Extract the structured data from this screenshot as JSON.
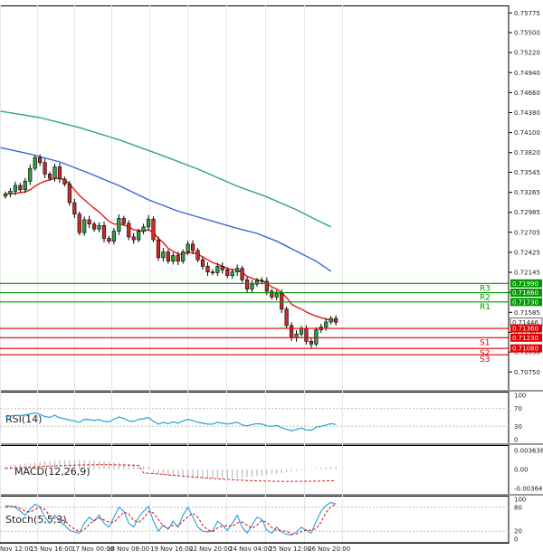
{
  "chart_data": {
    "type": "candlestick",
    "price_axis": {
      "range": [
        0.705,
        0.7588
      ],
      "ticks": [
        "0.75775",
        "0.75500",
        "0.75220",
        "0.74940",
        "0.74660",
        "0.74380",
        "0.74100",
        "0.73820",
        "0.73545",
        "0.73265",
        "0.72985",
        "0.72705",
        "0.72425",
        "0.72145",
        "0.71865",
        "0.71585",
        "0.71305",
        "0.71030",
        "0.70750"
      ]
    },
    "x_ticks": [
      "Nov 12:00",
      "15 Nov 16:00",
      "17 Nov 00:00",
      "18 Nov 08:00",
      "19 Nov 16:00",
      "22 Nov 20:00",
      "24 Nov 04:00",
      "25 Nov 12:00",
      "26 Nov 20:00"
    ],
    "current_price": "0.71446",
    "levels": [
      {
        "name": "R3",
        "value": "0.71990",
        "price": 0.7199,
        "color": "#009900"
      },
      {
        "name": "R2",
        "value": "0.71860",
        "price": 0.7186,
        "color": "#009900"
      },
      {
        "name": "R1",
        "value": "0.71730",
        "price": 0.7173,
        "color": "#009900"
      },
      {
        "name": "",
        "value": "0.71360",
        "price": 0.7136,
        "color": "#e00000"
      },
      {
        "name": "S1",
        "value": "0.71230",
        "price": 0.7123,
        "color": "#e00000"
      },
      {
        "name": "S2",
        "value": "0.71080",
        "price": 0.7108,
        "color": "#e00000"
      },
      {
        "name": "S3",
        "value": "",
        "price": 0.7108,
        "color": "#e00000"
      }
    ],
    "close": [
      0.7324,
      0.7328,
      0.7336,
      0.733,
      0.7342,
      0.736,
      0.7375,
      0.7368,
      0.7352,
      0.7346,
      0.7362,
      0.7345,
      0.7338,
      0.7312,
      0.7296,
      0.727,
      0.7288,
      0.7282,
      0.7275,
      0.728,
      0.7262,
      0.7258,
      0.7272,
      0.729,
      0.7283,
      0.7264,
      0.726,
      0.7272,
      0.7278,
      0.7289,
      0.726,
      0.7235,
      0.7243,
      0.723,
      0.7238,
      0.723,
      0.7243,
      0.7254,
      0.7245,
      0.7232,
      0.7223,
      0.7215,
      0.7214,
      0.7223,
      0.7218,
      0.721,
      0.7215,
      0.722,
      0.7204,
      0.7191,
      0.7198,
      0.7203,
      0.7202,
      0.7188,
      0.718,
      0.7185,
      0.7163,
      0.714,
      0.7123,
      0.7128,
      0.7136,
      0.7118,
      0.7114,
      0.7134,
      0.7138,
      0.7145,
      0.715,
      0.71446
    ],
    "ma_fast": [
      0.7324,
      0.7325,
      0.7325,
      0.7326,
      0.7327,
      0.733,
      0.7335,
      0.7339,
      0.7342,
      0.7344,
      0.7346,
      0.7346,
      0.7344,
      0.7338,
      0.733,
      0.7322,
      0.7316,
      0.731,
      0.7304,
      0.7299,
      0.7292,
      0.7286,
      0.7282,
      0.7282,
      0.7281,
      0.7278,
      0.7274,
      0.7273,
      0.7272,
      0.7274,
      0.727,
      0.7262,
      0.7256,
      0.7248,
      0.7244,
      0.724,
      0.724,
      0.7242,
      0.7242,
      0.724,
      0.7236,
      0.7232,
      0.7228,
      0.7226,
      0.7223,
      0.722,
      0.7218,
      0.7218,
      0.7214,
      0.7209,
      0.7206,
      0.7204,
      0.7203,
      0.7199,
      0.7194,
      0.7191,
      0.7186,
      0.7179,
      0.717,
      0.7166,
      0.7163,
      0.7159,
      0.7156,
      0.7153,
      0.7151,
      0.7149,
      0.7148,
      0.7147
    ]
  },
  "ma_blue": [
    [
      0,
      0.7389
    ],
    [
      6,
      0.738
    ],
    [
      12,
      0.7369
    ],
    [
      18,
      0.7353
    ],
    [
      24,
      0.7336
    ],
    [
      30,
      0.7316
    ],
    [
      36,
      0.73
    ],
    [
      42,
      0.7288
    ],
    [
      48,
      0.7276
    ],
    [
      52,
      0.7269
    ],
    [
      56,
      0.7258
    ],
    [
      60,
      0.7244
    ],
    [
      64,
      0.723
    ],
    [
      67,
      0.7216
    ]
  ],
  "ma_green": [
    [
      0,
      0.744
    ],
    [
      8,
      0.7431
    ],
    [
      16,
      0.7417
    ],
    [
      24,
      0.74
    ],
    [
      32,
      0.738
    ],
    [
      40,
      0.7359
    ],
    [
      48,
      0.7335
    ],
    [
      54,
      0.732
    ],
    [
      60,
      0.7302
    ],
    [
      64,
      0.7288
    ],
    [
      67,
      0.7278
    ]
  ],
  "rsi": {
    "label": "RSI(14)",
    "ticks": [
      "100",
      "70",
      "30",
      "0"
    ],
    "values": [
      52,
      53,
      55,
      54,
      56,
      58,
      60,
      57,
      52,
      50,
      55,
      49,
      47,
      44,
      42,
      39,
      46,
      45,
      43,
      45,
      41,
      40,
      46,
      51,
      48,
      42,
      41,
      46,
      47,
      50,
      41,
      35,
      39,
      36,
      40,
      37,
      42,
      46,
      43,
      39,
      37,
      35,
      35,
      39,
      37,
      35,
      37,
      39,
      33,
      31,
      34,
      36,
      35,
      31,
      30,
      32,
      27,
      23,
      20,
      23,
      26,
      22,
      21,
      28,
      30,
      33,
      36,
      34
    ]
  },
  "macd": {
    "label": "MACD(12,26,9)",
    "ticks": [
      "0.003638",
      "0.00",
      "-0.003646"
    ]
  },
  "stoch": {
    "label": "Stoch(5,5,3)",
    "ticks": [
      "100",
      "80",
      "20",
      "0"
    ],
    "k": [
      85,
      82,
      80,
      70,
      60,
      75,
      88,
      80,
      55,
      40,
      60,
      45,
      35,
      22,
      18,
      15,
      40,
      55,
      45,
      60,
      40,
      30,
      55,
      80,
      70,
      40,
      30,
      55,
      70,
      82,
      45,
      20,
      35,
      25,
      45,
      30,
      60,
      80,
      55,
      30,
      20,
      18,
      20,
      45,
      35,
      22,
      40,
      60,
      30,
      15,
      35,
      55,
      50,
      22,
      15,
      30,
      18,
      12,
      10,
      18,
      30,
      22,
      15,
      45,
      70,
      85,
      92,
      88
    ],
    "d": [
      80,
      82,
      82,
      77,
      70,
      68,
      74,
      81,
      74,
      58,
      52,
      48,
      47,
      34,
      25,
      18,
      24,
      37,
      47,
      53,
      48,
      43,
      42,
      55,
      68,
      63,
      47,
      42,
      52,
      69,
      66,
      49,
      33,
      27,
      35,
      33,
      45,
      57,
      65,
      55,
      35,
      23,
      19,
      28,
      33,
      34,
      32,
      41,
      43,
      35,
      27,
      35,
      47,
      42,
      29,
      22,
      21,
      20,
      13,
      13,
      19,
      23,
      22,
      27,
      43,
      67,
      82,
      88
    ]
  }
}
